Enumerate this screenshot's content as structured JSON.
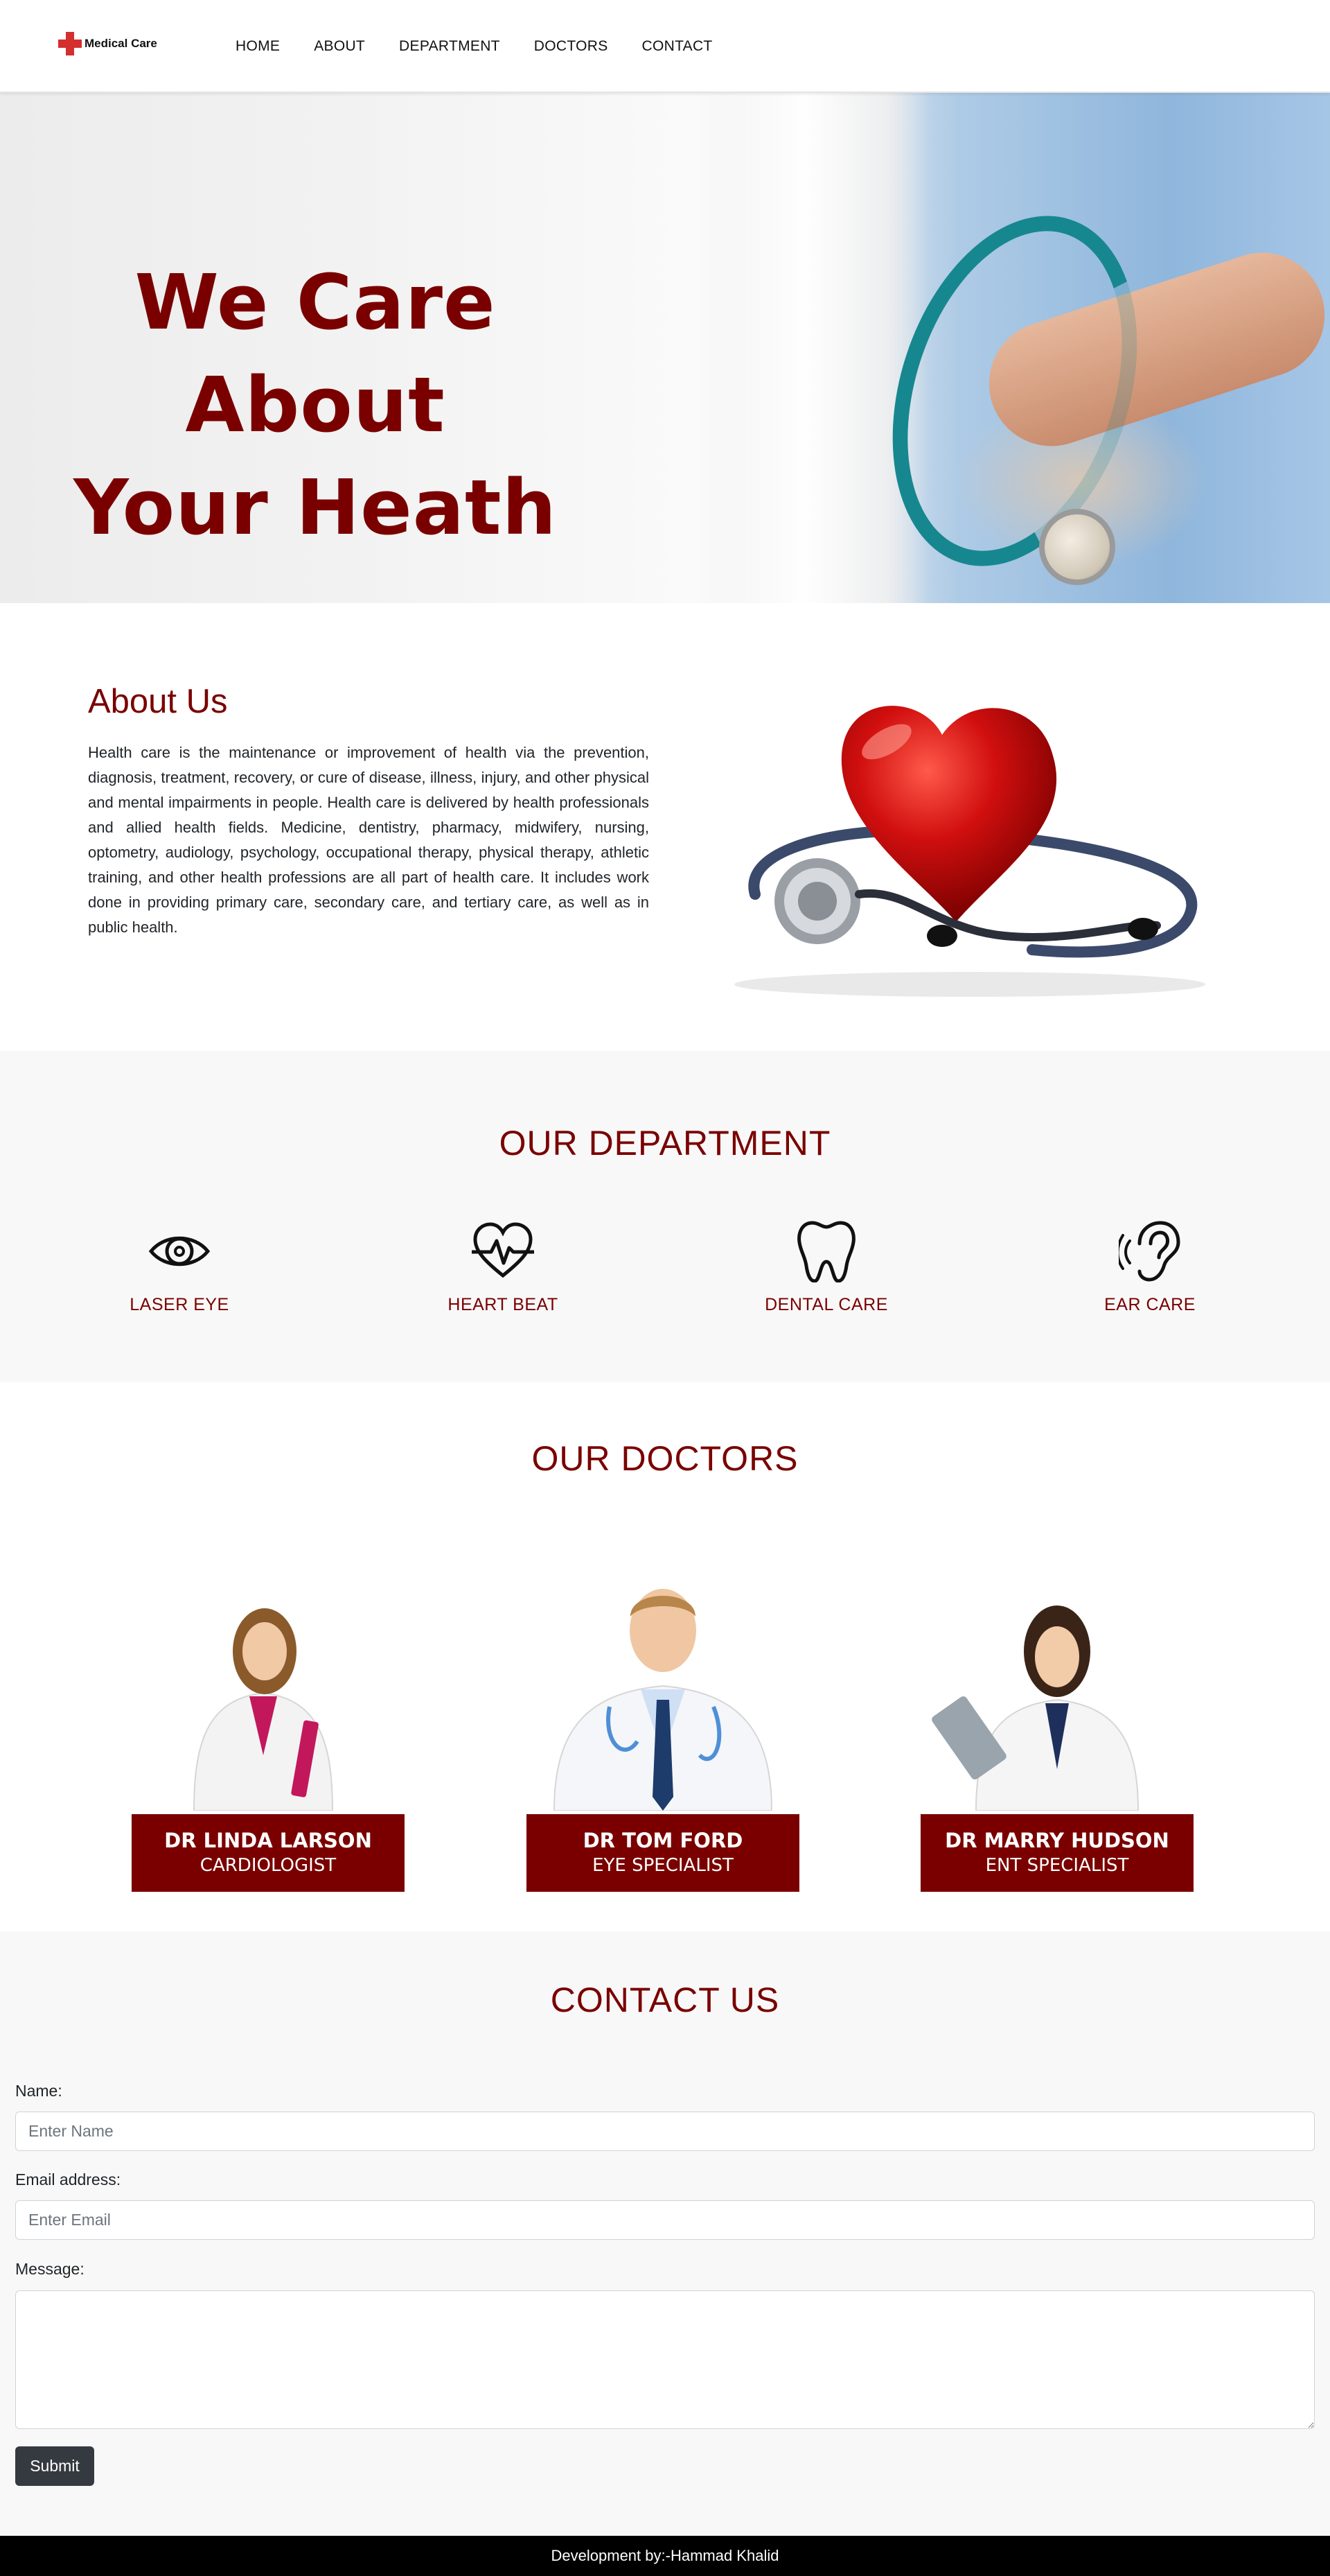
{
  "brand": {
    "name": "Medical Care",
    "logo_icon": "red-cross-icon"
  },
  "nav": {
    "items": [
      "HOME",
      "ABOUT",
      "DEPARTMENT",
      "DOCTORS",
      "CONTACT"
    ]
  },
  "hero": {
    "title_line1": "We Care About",
    "title_line2": "Your Heath"
  },
  "about": {
    "title": "About Us",
    "text": "Health care is the maintenance or improvement of health via the prevention, diagnosis, treatment, recovery, or cure of disease, illness, injury, and other physical and mental impairments in people. Health care is delivered by health professionals and allied health fields. Medicine, dentistry, pharmacy, midwifery, nursing, optometry, audiology, psychology, occupational therapy, physical therapy, athletic training, and other health professions are all part of health care. It includes work done in providing primary care, secondary care, and tertiary care, as well as in public health."
  },
  "department": {
    "title": "OUR DEPARTMENT",
    "items": [
      {
        "label": "LASER EYE",
        "icon": "eye-icon"
      },
      {
        "label": "HEART BEAT",
        "icon": "heartbeat-icon"
      },
      {
        "label": "DENTAL CARE",
        "icon": "tooth-icon"
      },
      {
        "label": "EAR CARE",
        "icon": "ear-icon"
      }
    ]
  },
  "doctors": {
    "title": "OUR DOCTORS",
    "items": [
      {
        "name": "DR LINDA LARSON",
        "specialty": "CARDIOLOGIST"
      },
      {
        "name": "DR TOM FORD",
        "specialty": "EYE SPECIALIST"
      },
      {
        "name": "DR MARRY HUDSON",
        "specialty": "ENT SPECIALIST"
      }
    ]
  },
  "contact": {
    "title": "CONTACT US",
    "name_label": "Name:",
    "name_placeholder": "Enter Name",
    "email_label": "Email address:",
    "email_placeholder": "Enter Email",
    "message_label": "Message:",
    "submit_label": "Submit"
  },
  "footer": {
    "text": "Development by:-Hammad Khalid"
  },
  "colors": {
    "accent": "#7a0000",
    "button": "#343a40",
    "section_bg": "#f8f8f8",
    "footer_bg": "#000000"
  }
}
